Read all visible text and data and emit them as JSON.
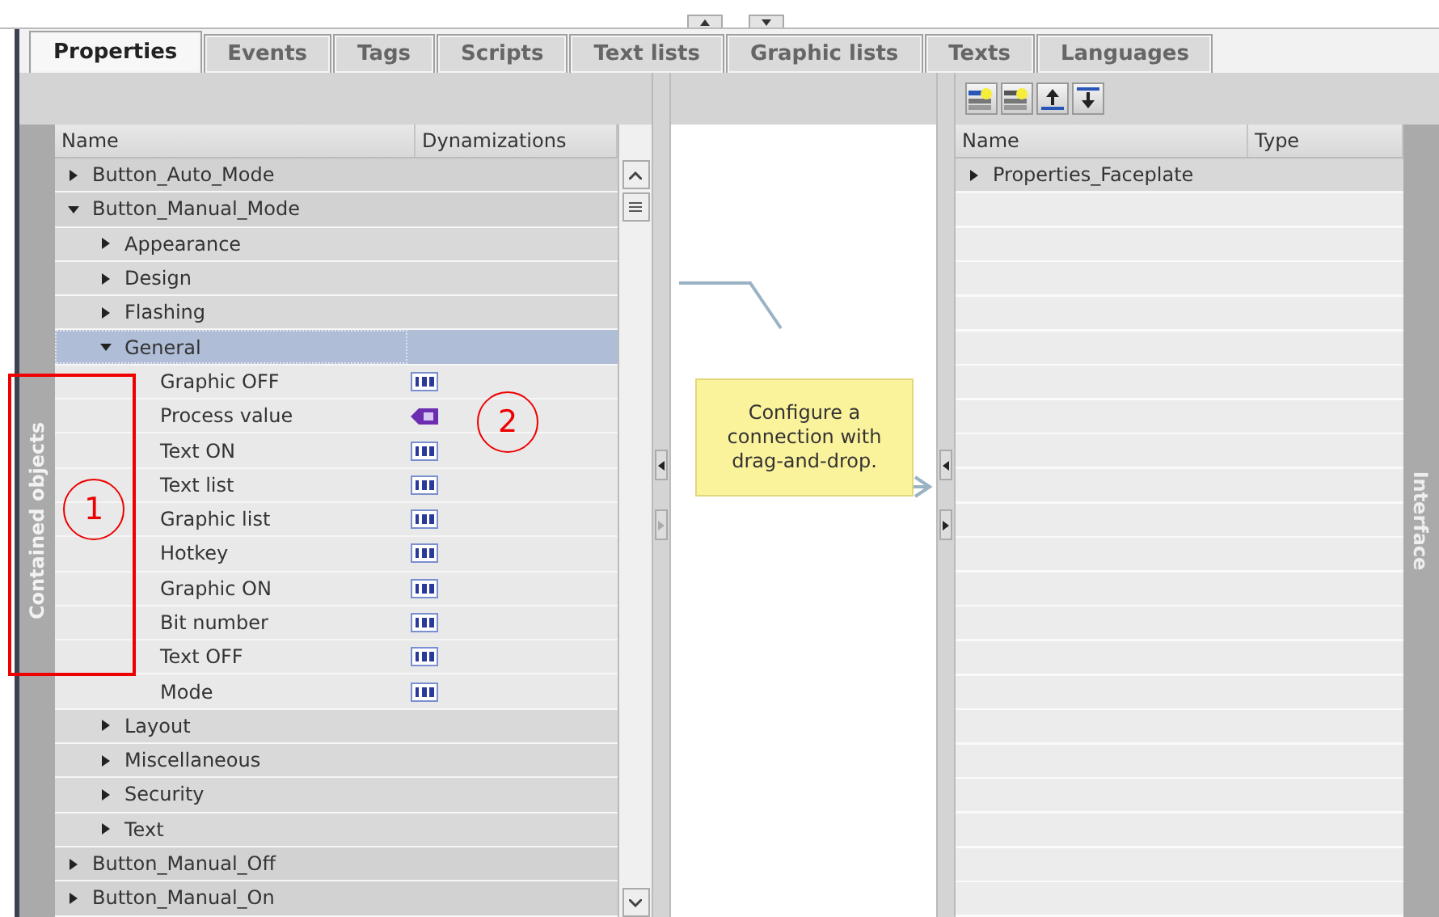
{
  "tabs": [
    {
      "label": "Properties",
      "selected": true
    },
    {
      "label": "Events",
      "selected": false
    },
    {
      "label": "Tags",
      "selected": false
    },
    {
      "label": "Scripts",
      "selected": false
    },
    {
      "label": "Text lists",
      "selected": false
    },
    {
      "label": "Graphic lists",
      "selected": false
    },
    {
      "label": "Texts",
      "selected": false
    },
    {
      "label": "Languages",
      "selected": false
    }
  ],
  "left_panel": {
    "sidebar_label": "Contained objects",
    "columns": [
      "Name",
      "Dynamizations"
    ],
    "tree": [
      {
        "name": "Button_Auto_Mode",
        "expanded": false,
        "selected": false
      },
      {
        "name": "Button_Manual_Mode",
        "expanded": true,
        "selected": false,
        "children": [
          {
            "name": "Appearance",
            "expanded": false,
            "selected": false
          },
          {
            "name": "Design",
            "expanded": false,
            "selected": false
          },
          {
            "name": "Flashing",
            "expanded": false,
            "selected": false
          },
          {
            "name": "General",
            "expanded": true,
            "selected": true,
            "children": [
              {
                "name": "Graphic OFF",
                "kind": "constant",
                "selected": false
              },
              {
                "name": "Process value",
                "kind": "tag",
                "selected": false
              },
              {
                "name": "Text ON",
                "kind": "constant",
                "selected": false
              },
              {
                "name": "Text list",
                "kind": "constant",
                "selected": false
              },
              {
                "name": "Graphic list",
                "kind": "constant",
                "selected": false
              },
              {
                "name": "Hotkey",
                "kind": "constant",
                "selected": false
              },
              {
                "name": "Graphic ON",
                "kind": "constant",
                "selected": false
              },
              {
                "name": "Bit number",
                "kind": "constant",
                "selected": false
              },
              {
                "name": "Text OFF",
                "kind": "constant",
                "selected": false
              },
              {
                "name": "Mode",
                "kind": "constant",
                "selected": false
              }
            ]
          },
          {
            "name": "Layout",
            "expanded": false,
            "selected": false
          },
          {
            "name": "Miscellaneous",
            "expanded": false,
            "selected": false
          },
          {
            "name": "Security",
            "expanded": false,
            "selected": false
          },
          {
            "name": "Text",
            "expanded": false,
            "selected": false
          }
        ]
      },
      {
        "name": "Button_Manual_Off",
        "expanded": false,
        "selected": false
      },
      {
        "name": "Button_Manual_On",
        "expanded": false,
        "selected": false
      }
    ]
  },
  "note": {
    "text": "Configure a connection with drag-and-drop."
  },
  "right_panel": {
    "columns": [
      "Name",
      "Type"
    ],
    "sidebar_label": "Interface",
    "rows": [
      {
        "name": "Properties_Faceplate",
        "expanded": false
      }
    ]
  },
  "annotations": [
    {
      "label": "1"
    },
    {
      "label": "2"
    }
  ]
}
